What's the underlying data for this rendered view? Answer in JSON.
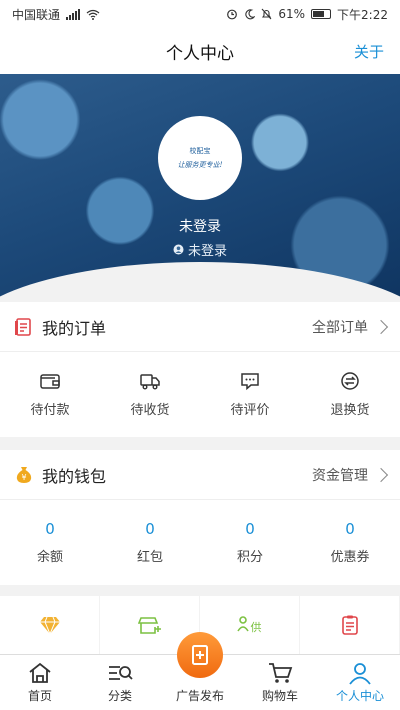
{
  "status_bar": {
    "carrier": "中国联通",
    "battery": "61%",
    "time": "下午2:22"
  },
  "nav": {
    "title": "个人中心",
    "about": "关于"
  },
  "profile": {
    "name": "未登录",
    "status": "未登录",
    "avatar_text_top": "校配宝",
    "avatar_text_bottom": "让服务更专业!"
  },
  "orders": {
    "title": "我的订单",
    "all_label": "全部订单",
    "items": [
      {
        "label": "待付款",
        "icon": "wallet-icon"
      },
      {
        "label": "待收货",
        "icon": "truck-icon"
      },
      {
        "label": "待评价",
        "icon": "comment-icon"
      },
      {
        "label": "退换货",
        "icon": "return-icon"
      }
    ]
  },
  "wallet": {
    "title": "我的钱包",
    "manage_label": "资金管理",
    "items": [
      {
        "label": "余额",
        "value": "0"
      },
      {
        "label": "红包",
        "value": "0"
      },
      {
        "label": "积分",
        "value": "0"
      },
      {
        "label": "优惠券",
        "value": "0"
      }
    ]
  },
  "strip": {
    "tile2_text": "供"
  },
  "tabbar": {
    "items": [
      {
        "label": "首页",
        "icon": "home-icon"
      },
      {
        "label": "分类",
        "icon": "category-icon"
      },
      {
        "label": "广告发布",
        "icon": "ad-publish-icon"
      },
      {
        "label": "购物车",
        "icon": "cart-icon"
      },
      {
        "label": "个人中心",
        "icon": "user-icon"
      }
    ]
  },
  "colors": {
    "accent": "#1a8fd6",
    "fab": "#f47a1f",
    "hero": "#1d4a7a"
  }
}
